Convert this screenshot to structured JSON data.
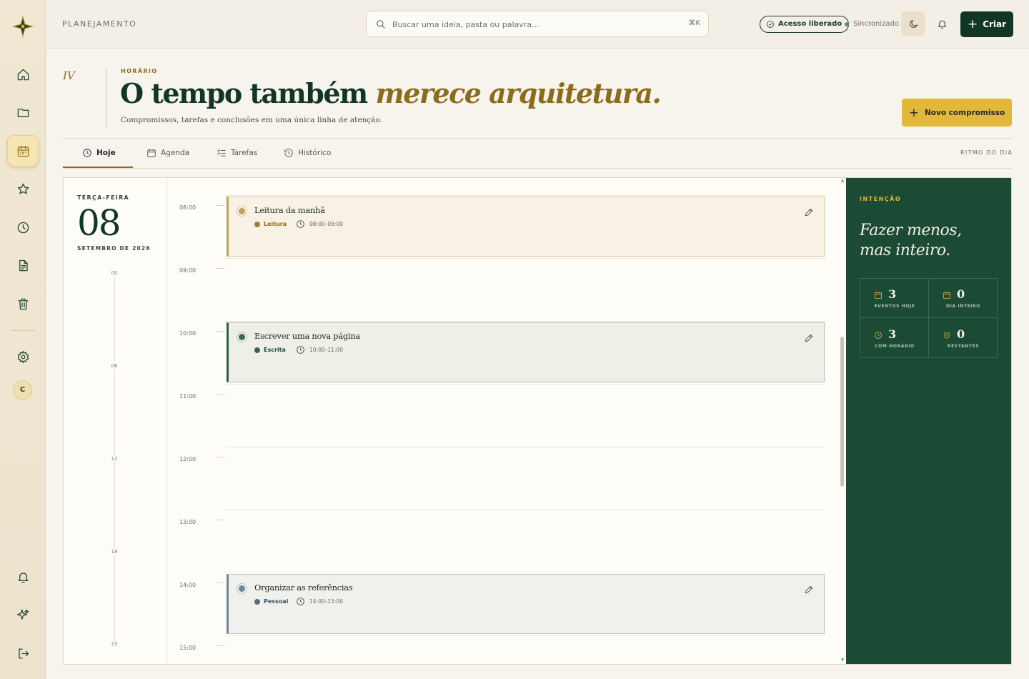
{
  "topbar": {
    "breadcrumb": "PLANEJAMENTO",
    "search_placeholder": "Buscar uma ideia, pasta ou palavra...",
    "search_shortcut": "⌘K",
    "access_badge": "Acesso liberado",
    "sync_status": "Sincronizado",
    "create_label": "Criar"
  },
  "sidebar": {
    "avatar_initial": "C"
  },
  "header": {
    "numeral": "IV",
    "eyebrow": "HORÁRIO",
    "title_main": "O tempo também ",
    "title_accent": "merece arquitetura.",
    "subtitle": "Compromissos, tarefas e conclusões em uma única linha de atenção.",
    "new_button": "Novo compromisso"
  },
  "tabs": [
    {
      "label": "Hoje",
      "active": true
    },
    {
      "label": "Agenda",
      "active": false
    },
    {
      "label": "Tarefas",
      "active": false
    },
    {
      "label": "Histórico",
      "active": false
    }
  ],
  "tabs_right_label": "RITMO DO DIA",
  "day": {
    "weekday": "TERÇA-FEIRA",
    "number": "08",
    "month_year": "SETEMBRO DE 2026",
    "mini_ticks": [
      "00",
      "06",
      "12",
      "18",
      "23"
    ]
  },
  "hours": [
    "08:00",
    "09:00",
    "10:00",
    "11:00",
    "12:00",
    "13:00",
    "14:00",
    "15:00"
  ],
  "events": [
    {
      "title": "Leitura da manhã",
      "tag": "Leitura",
      "time": "08:00–09:00",
      "tag_color": "#8c6c1c",
      "dot_color": "#b9a15e",
      "bg": "#f8f2e6",
      "border": "#d9c9a3",
      "accent": "#b9a15e"
    },
    {
      "title": "Escrever uma nova página",
      "tag": "Escrita",
      "time": "10:00–11:00",
      "tag_color": "#1d4a35",
      "dot_color": "#3d6b55",
      "bg": "#eef0e7",
      "border": "#b3c2b5",
      "accent": "#2f5e47"
    },
    {
      "title": "Organizar as referências",
      "tag": "Pessoal",
      "time": "14:00–15:00",
      "tag_color": "#3d5566",
      "dot_color": "#6f8797",
      "bg": "#f0f1ec",
      "border": "#bcc5c7",
      "accent": "#6f8797"
    }
  ],
  "panel": {
    "eyebrow": "INTENÇÃO",
    "quote_line1": "Fazer menos,",
    "quote_line2": "mas inteiro.",
    "stats": [
      {
        "icon": "calendar-icon",
        "value": "3",
        "label": "EVENTOS HOJE"
      },
      {
        "icon": "calendar-icon",
        "value": "0",
        "label": "DIA INTEIRO"
      },
      {
        "icon": "clock-icon",
        "value": "3",
        "label": "COM HORÁRIO"
      },
      {
        "icon": "alarm-icon",
        "value": "0",
        "label": "RESTANTES"
      }
    ]
  },
  "colors": {
    "brand_dark": "#123626",
    "accent_gold": "#8c6c1c",
    "button_yellow": "#e3b83a",
    "panel_green": "#1b4a35"
  }
}
